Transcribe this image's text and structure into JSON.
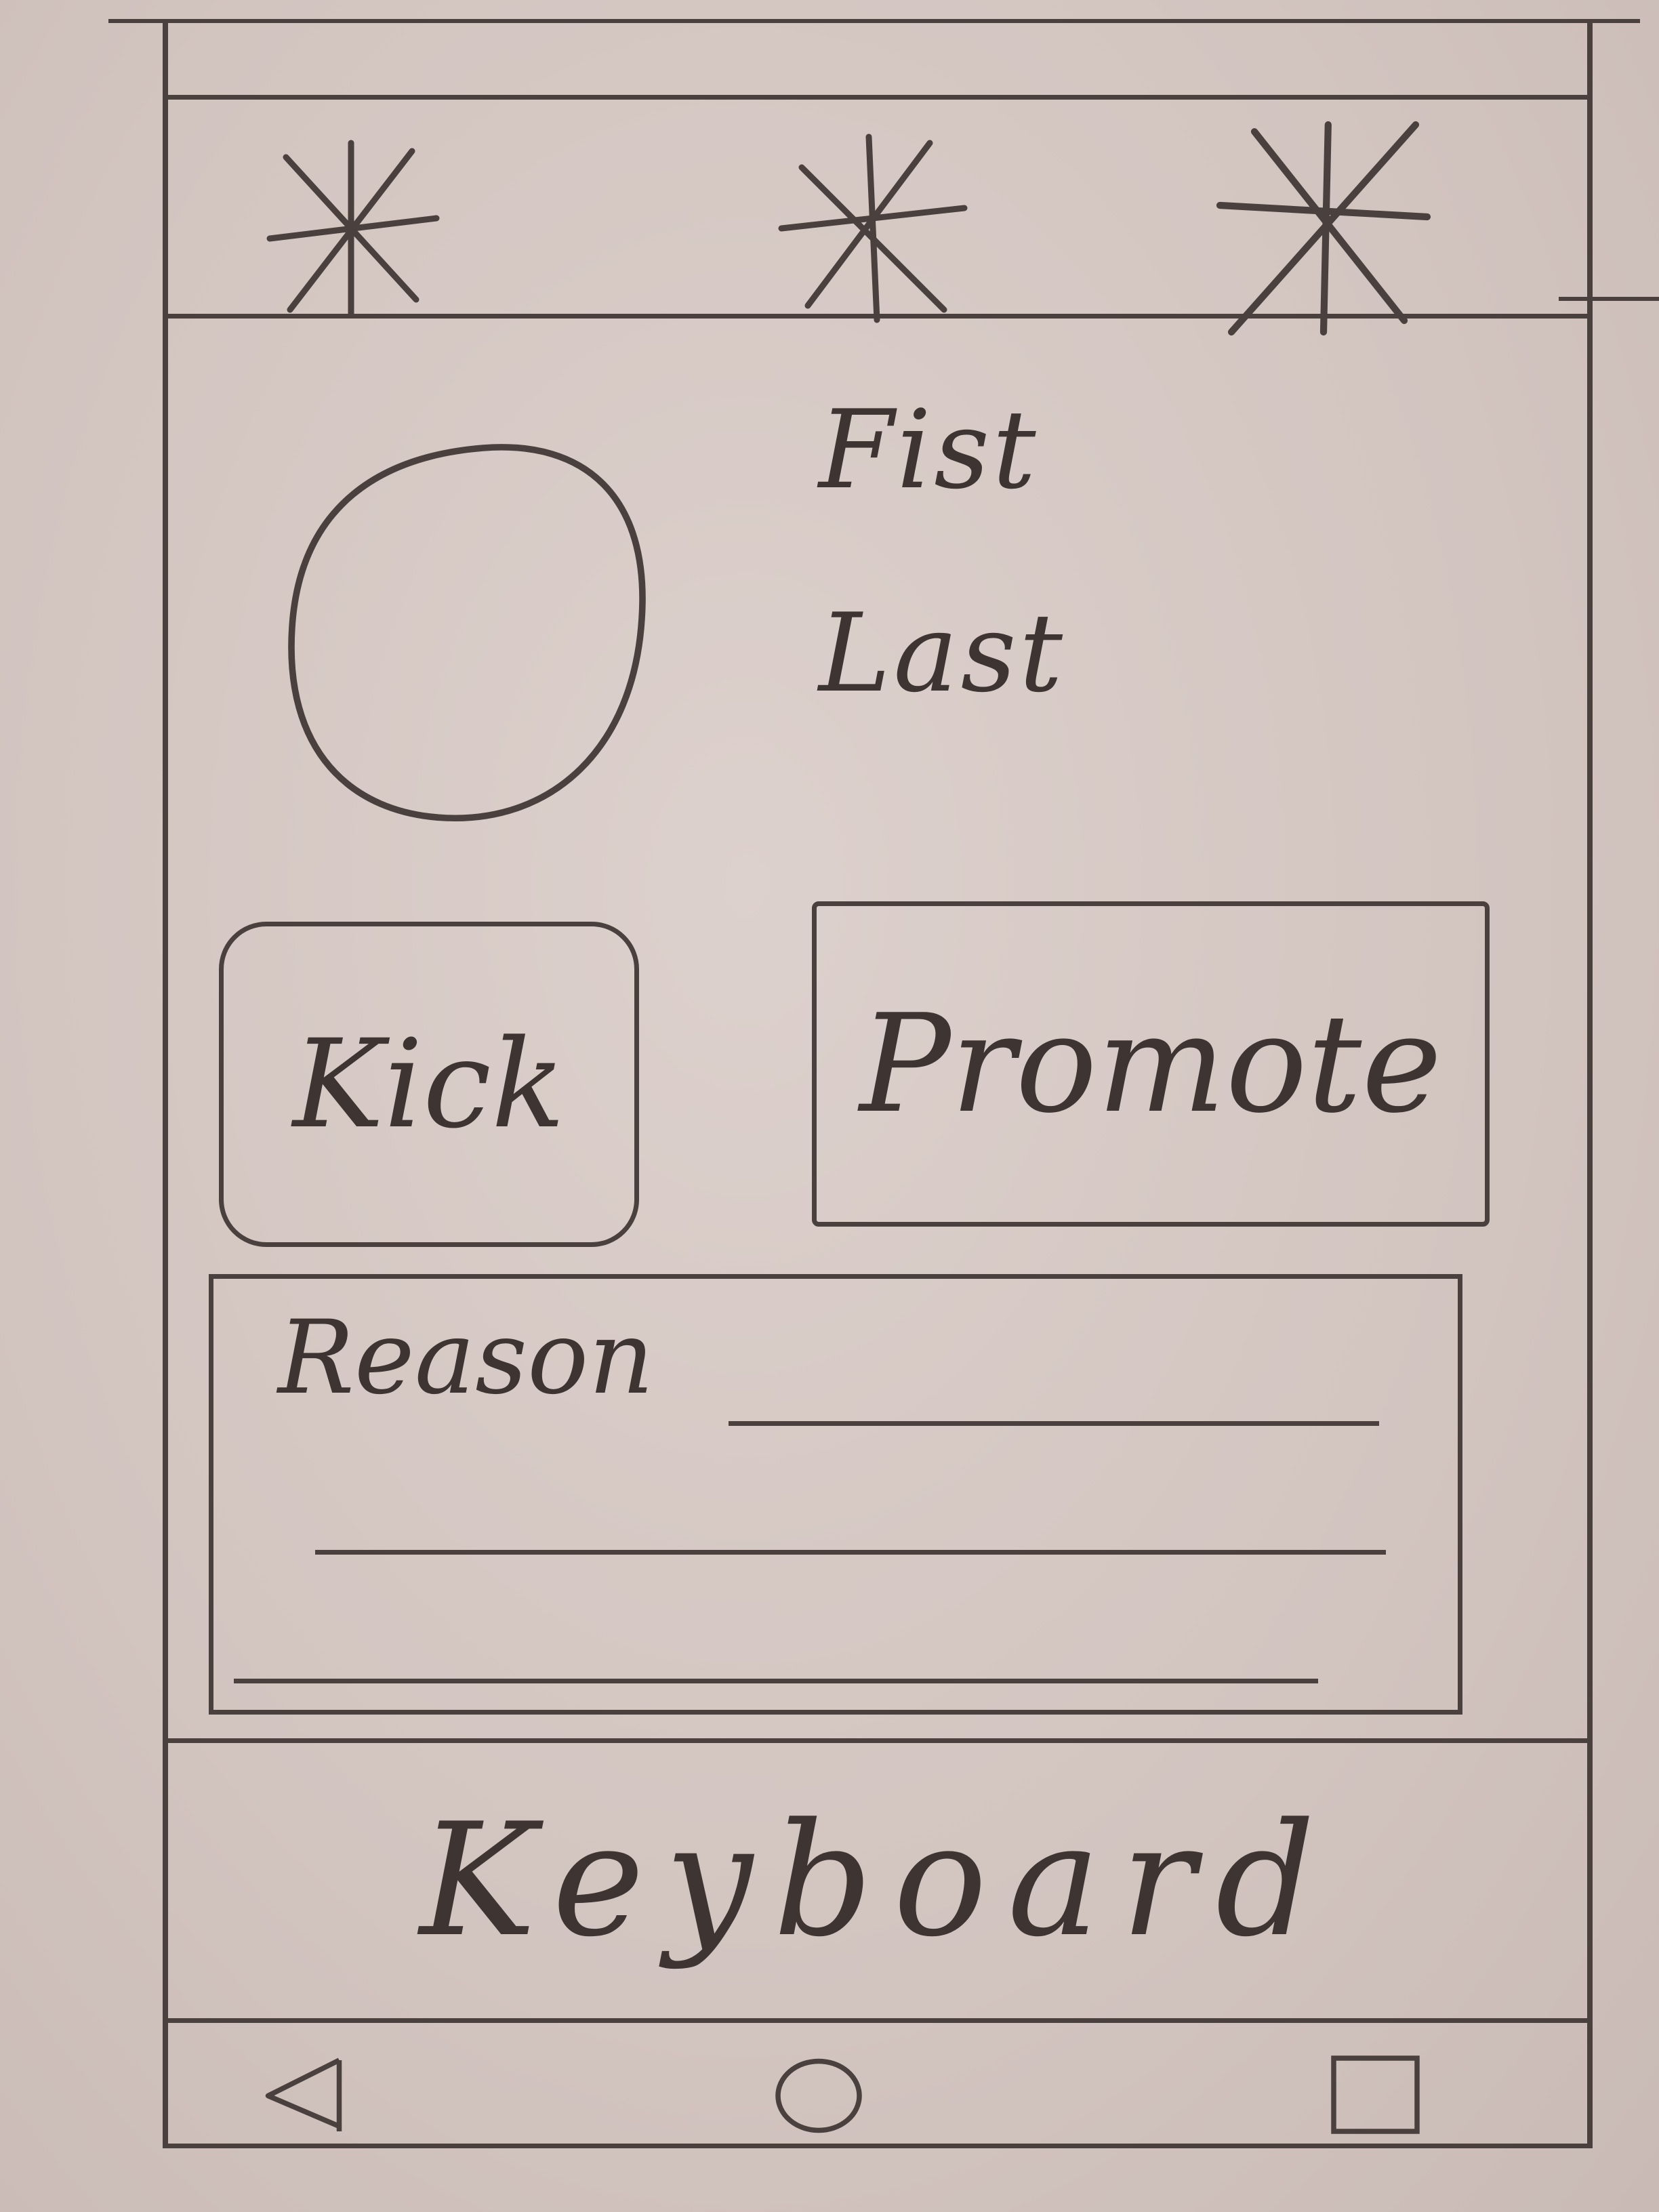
{
  "tabs": [
    {
      "icon": "asterisk-icon"
    },
    {
      "icon": "asterisk-icon"
    },
    {
      "icon": "asterisk-icon"
    }
  ],
  "profile": {
    "avatar_icon": "avatar-circle-icon",
    "first_name": "Fist",
    "last_name": "Last"
  },
  "actions": {
    "kick_label": "Kick",
    "promote_label": "Promote"
  },
  "reason": {
    "label": "Reason"
  },
  "keyboard": {
    "label": "Keyboard"
  },
  "nav": {
    "back_icon": "triangle-back-icon",
    "home_icon": "circle-home-icon",
    "recents_icon": "square-recents-icon"
  },
  "colors": {
    "ink": "#4a403d",
    "paper": "#d6c9c4"
  }
}
